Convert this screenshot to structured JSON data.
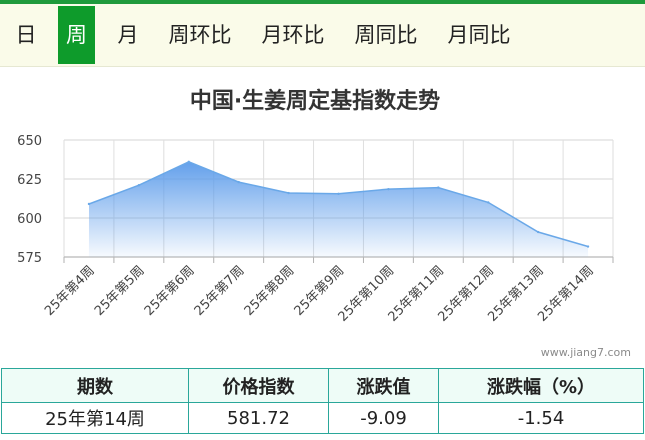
{
  "tabs": [
    {
      "label": "日",
      "active": false
    },
    {
      "label": "周",
      "active": true
    },
    {
      "label": "月",
      "active": false
    },
    {
      "label": "周环比",
      "active": false
    },
    {
      "label": "月环比",
      "active": false
    },
    {
      "label": "周同比",
      "active": false
    },
    {
      "label": "月同比",
      "active": false
    }
  ],
  "colors": {
    "active_tab": "#0e9b2b",
    "line": "#6aa8e8",
    "area_top": "#5b9bea",
    "table_border": "#2aa79a"
  },
  "chart_data": {
    "type": "area",
    "title": "中国·生姜周定基指数走势",
    "xlabel": "",
    "ylabel": "",
    "categories": [
      "25年第4周",
      "25年第5周",
      "25年第6周",
      "25年第7周",
      "25年第8周",
      "25年第9周",
      "25年第10周",
      "25年第11周",
      "25年第12周",
      "25年第13周",
      "25年第14周"
    ],
    "values": [
      609,
      621,
      636,
      623,
      616,
      615.5,
      618.5,
      619.5,
      610,
      591,
      581.72
    ],
    "ylim": [
      575,
      650
    ],
    "yticks": [
      575,
      600,
      625,
      650
    ],
    "grid": true,
    "legend": "none"
  },
  "watermark": "www.jiang7.com",
  "table": {
    "headers": [
      "期数",
      "价格指数",
      "涨跌值",
      "涨跌幅（%）"
    ],
    "row": [
      "25年第14周",
      "581.72",
      "-9.09",
      "-1.54"
    ]
  }
}
